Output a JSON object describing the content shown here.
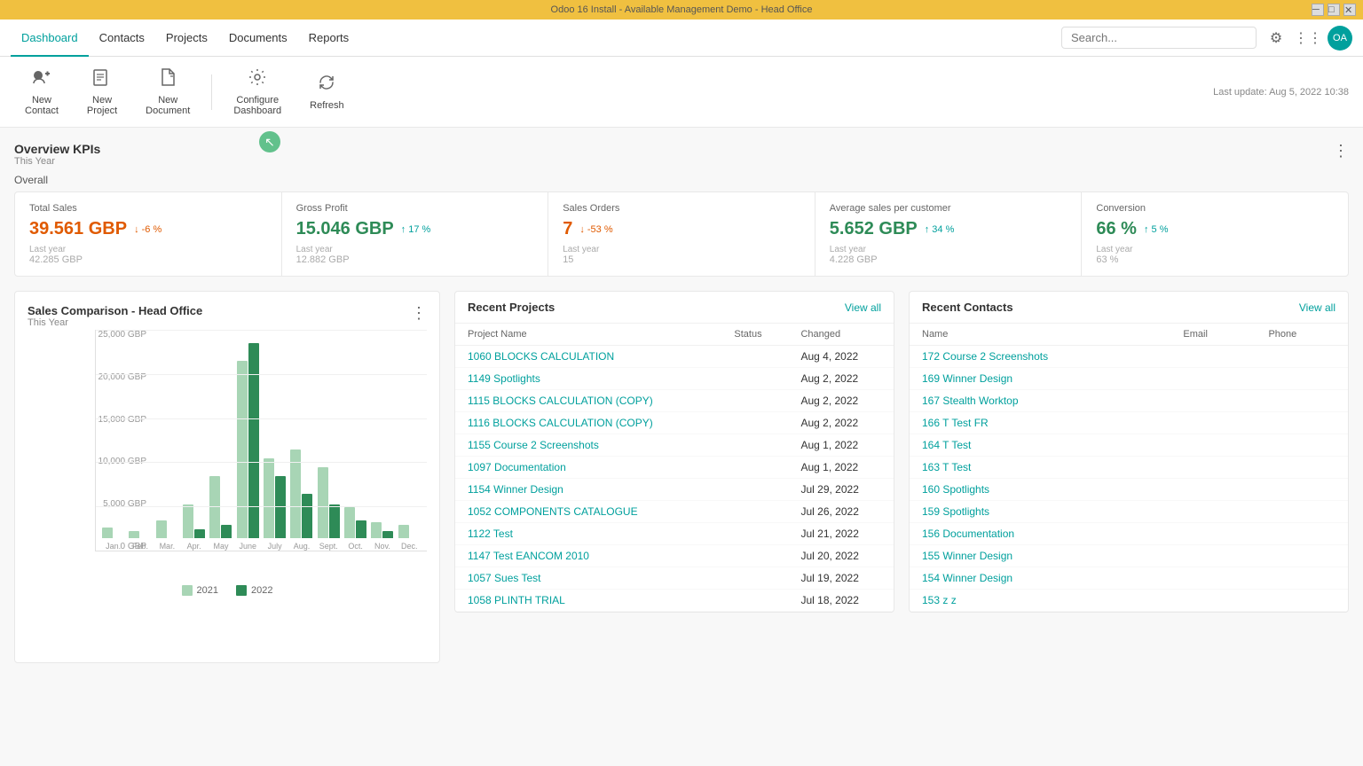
{
  "titleBar": {
    "text": "Odoo 16 Install - Available Management Demo - Head Office",
    "controls": [
      "minimize",
      "maximize",
      "close"
    ]
  },
  "nav": {
    "items": [
      "Dashboard",
      "Contacts",
      "Projects",
      "Documents",
      "Reports"
    ],
    "activeItem": "Dashboard"
  },
  "search": {
    "placeholder": "Search..."
  },
  "toolbar": {
    "lastUpdate": "Last update: Aug 5, 2022 10:38",
    "buttons": [
      {
        "id": "new-contact",
        "label": "New\nContact",
        "icon": "👤+"
      },
      {
        "id": "new-project",
        "label": "New\nProject",
        "icon": "📋"
      },
      {
        "id": "new-document",
        "label": "New\nDocument",
        "icon": "📎"
      },
      {
        "id": "configure-dashboard",
        "label": "Configure\nDashboard",
        "icon": "⚙️"
      },
      {
        "id": "refresh",
        "label": "Refresh",
        "icon": "🔄"
      }
    ]
  },
  "kpiSection": {
    "title": "Overview KPIs",
    "subtitle": "This Year",
    "overallLabel": "Overall",
    "cards": [
      {
        "id": "total-sales",
        "label": "Total Sales",
        "value": "39.561 GBP",
        "valueColor": "red",
        "badge": "↓ -6 %",
        "badgeType": "down",
        "lastYearLabel": "Last year",
        "lastYearValue": "42.285 GBP"
      },
      {
        "id": "gross-profit",
        "label": "Gross Profit",
        "value": "15.046 GBP",
        "valueColor": "green",
        "badge": "↑ 17 %",
        "badgeType": "up",
        "lastYearLabel": "Last year",
        "lastYearValue": "12.882 GBP"
      },
      {
        "id": "sales-orders",
        "label": "Sales Orders",
        "value": "7",
        "valueColor": "red",
        "badge": "↓ -53 %",
        "badgeType": "down",
        "lastYearLabel": "Last year",
        "lastYearValue": "15"
      },
      {
        "id": "avg-sales-per-customer",
        "label": "Average sales per customer",
        "value": "5.652 GBP",
        "valueColor": "green",
        "badge": "↑ 34 %",
        "badgeType": "up",
        "lastYearLabel": "Last year",
        "lastYearValue": "4.228 GBP"
      },
      {
        "id": "conversion",
        "label": "Conversion",
        "value": "66 %",
        "valueColor": "green",
        "badge": "↑ 5 %",
        "badgeType": "up",
        "lastYearLabel": "Last year",
        "lastYearValue": "63 %"
      }
    ]
  },
  "salesChart": {
    "title": "Sales Comparison - Head Office",
    "subtitle": "This Year",
    "yAxisLabels": [
      "0 GBP",
      "5,000 GBP",
      "10,000 GBP",
      "15,000 GBP",
      "20,000 GBP",
      "25,000 GBP"
    ],
    "months": [
      "Jan.",
      "Feb.",
      "Mar.",
      "Apr.",
      "May",
      "June",
      "July",
      "Aug.",
      "Sept.",
      "Oct.",
      "Nov.",
      "Dec."
    ],
    "legend": [
      {
        "year": "2021",
        "color": "y2021"
      },
      {
        "year": "2022",
        "color": "y2022"
      }
    ],
    "bars": [
      {
        "month": "Jan.",
        "y2021": 5,
        "y2022": 0
      },
      {
        "month": "Feb.",
        "y2021": 3,
        "y2022": 0
      },
      {
        "month": "Mar.",
        "y2021": 8,
        "y2022": 0
      },
      {
        "month": "Apr.",
        "y2021": 15,
        "y2022": 4
      },
      {
        "month": "May",
        "y2021": 28,
        "y2022": 6
      },
      {
        "month": "June",
        "y2021": 80,
        "y2022": 88
      },
      {
        "month": "July",
        "y2021": 36,
        "y2022": 28
      },
      {
        "month": "Aug.",
        "y2021": 40,
        "y2022": 20
      },
      {
        "month": "Sept.",
        "y2021": 32,
        "y2022": 15
      },
      {
        "month": "Oct.",
        "y2021": 14,
        "y2022": 8
      },
      {
        "month": "Nov.",
        "y2021": 7,
        "y2022": 3
      },
      {
        "month": "Dec.",
        "y2021": 6,
        "y2022": 0
      }
    ]
  },
  "recentProjects": {
    "title": "Recent Projects",
    "viewAllLabel": "View all",
    "columns": [
      "Project Name",
      "Status",
      "Changed"
    ],
    "rows": [
      {
        "name": "1060 BLOCKS CALCULATION",
        "status": "",
        "changed": "Aug 4, 2022"
      },
      {
        "name": "1149 Spotlights",
        "status": "",
        "changed": "Aug 2, 2022"
      },
      {
        "name": "1115 BLOCKS CALCULATION (COPY)",
        "status": "",
        "changed": "Aug 2, 2022"
      },
      {
        "name": "1116 BLOCKS CALCULATION (COPY)",
        "status": "",
        "changed": "Aug 2, 2022"
      },
      {
        "name": "1155 Course 2 Screenshots",
        "status": "",
        "changed": "Aug 1, 2022"
      },
      {
        "name": "1097 Documentation",
        "status": "",
        "changed": "Aug 1, 2022"
      },
      {
        "name": "1154 Winner Design",
        "status": "",
        "changed": "Jul 29, 2022"
      },
      {
        "name": "1052 COMPONENTS CATALOGUE",
        "status": "",
        "changed": "Jul 26, 2022"
      },
      {
        "name": "1122 Test",
        "status": "",
        "changed": "Jul 21, 2022"
      },
      {
        "name": "1147 Test EANCOM 2010",
        "status": "",
        "changed": "Jul 20, 2022"
      },
      {
        "name": "1057 Sues Test",
        "status": "",
        "changed": "Jul 19, 2022"
      },
      {
        "name": "1058 PLINTH TRIAL",
        "status": "",
        "changed": "Jul 18, 2022"
      }
    ]
  },
  "recentContacts": {
    "title": "Recent Contacts",
    "viewAllLabel": "View all",
    "columns": [
      "Name",
      "Email",
      "Phone"
    ],
    "rows": [
      {
        "name": "172 Course 2 Screenshots",
        "email": "",
        "phone": ""
      },
      {
        "name": "169 Winner Design",
        "email": "",
        "phone": ""
      },
      {
        "name": "167 Stealth Worktop",
        "email": "",
        "phone": ""
      },
      {
        "name": "166 T Test FR",
        "email": "",
        "phone": ""
      },
      {
        "name": "164 T Test",
        "email": "",
        "phone": ""
      },
      {
        "name": "163 T Test",
        "email": "",
        "phone": ""
      },
      {
        "name": "160 Spotlights",
        "email": "",
        "phone": ""
      },
      {
        "name": "159 Spotlights",
        "email": "",
        "phone": ""
      },
      {
        "name": "156 Documentation",
        "email": "",
        "phone": ""
      },
      {
        "name": "155 Winner Design",
        "email": "",
        "phone": ""
      },
      {
        "name": "154 Winner Design",
        "email": "",
        "phone": ""
      },
      {
        "name": "153 z z",
        "email": "",
        "phone": ""
      }
    ]
  }
}
